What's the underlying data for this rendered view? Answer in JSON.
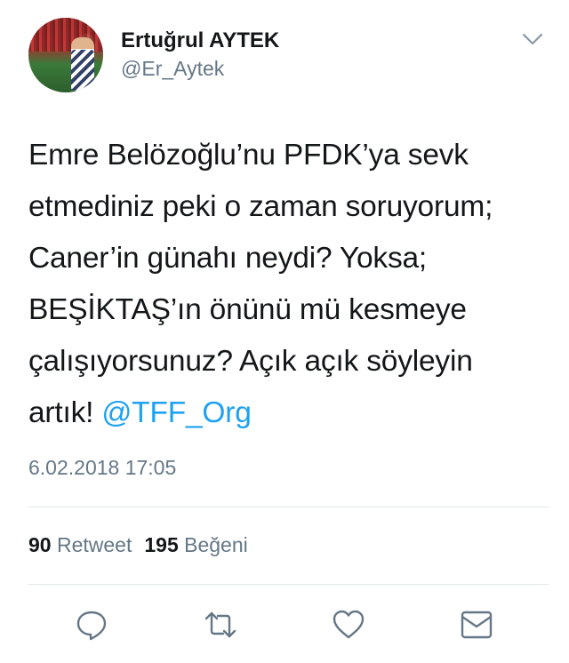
{
  "tweet": {
    "author_name": "Ertuğrul AYTEK",
    "author_handle": "@Er_Aytek",
    "text_lines": [
      "Emre Belözoğlu’nu PFDK’ya sevk",
      "etmediniz peki o zaman soruyorum;",
      "Caner’in günahı neydi? Yoksa;",
      "BEŞİKTAŞ’ın önünü mü kesmeye",
      "çalışıyorsunuz? Açık açık söyleyin",
      "artık!"
    ],
    "mention": "@TFF_Org",
    "timestamp": "6.02.2018 17:05",
    "retweet_count": "90",
    "retweet_label": "Retweet",
    "like_count": "195",
    "like_label": "Beğeni"
  },
  "icons": {
    "menu": "chevron-down-icon",
    "reply": "reply-icon",
    "retweet": "retweet-icon",
    "like": "heart-icon",
    "dm": "envelope-icon"
  },
  "colors": {
    "text": "#14171a",
    "secondary": "#657786",
    "link": "#1da1f2",
    "divider": "#e1e8ed"
  }
}
